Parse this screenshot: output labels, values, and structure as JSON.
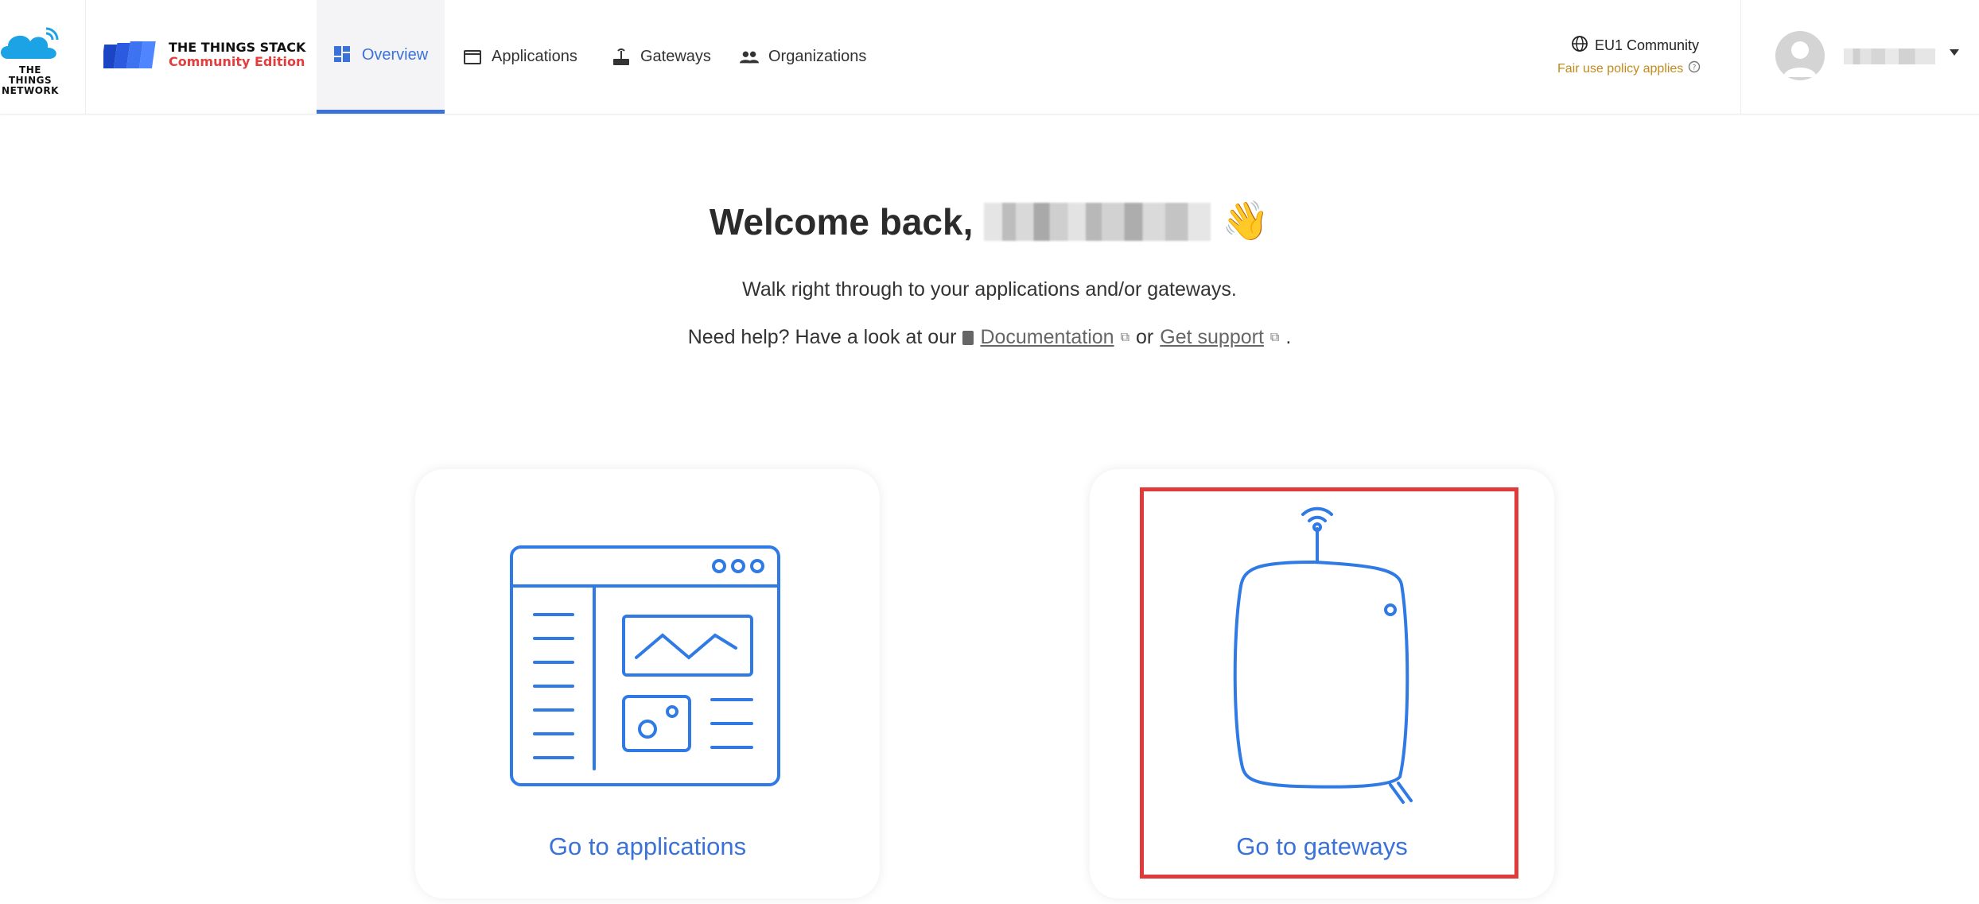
{
  "brand": {
    "ttn_logo_text": "THE THINGS NETWORK",
    "stack_title": "THE THINGS STACK",
    "stack_edition": "Community Edition"
  },
  "nav": {
    "items": [
      {
        "label": "Overview",
        "icon": "dashboard-icon",
        "active": true
      },
      {
        "label": "Applications",
        "icon": "window-icon",
        "active": false
      },
      {
        "label": "Gateways",
        "icon": "router-icon",
        "active": false
      },
      {
        "label": "Organizations",
        "icon": "people-icon",
        "active": false
      }
    ]
  },
  "cluster": {
    "name": "EU1 Community",
    "policy": "Fair use policy applies"
  },
  "welcome": {
    "greeting": "Welcome back,",
    "subtitle": "Walk right through to your applications and/or gateways.",
    "help_prefix": "Need help? Have a look at our",
    "doc_link": "Documentation",
    "or_text": "or",
    "support_link": "Get support",
    "period": ".",
    "wave_emoji": "👋"
  },
  "cards": {
    "applications_label": "Go to applications",
    "gateways_label": "Go to gateways"
  },
  "colors": {
    "accent": "#3b72d9",
    "policy": "#c28a1a",
    "highlight": "#e03a3a",
    "brand_red": "#e33d3d"
  }
}
